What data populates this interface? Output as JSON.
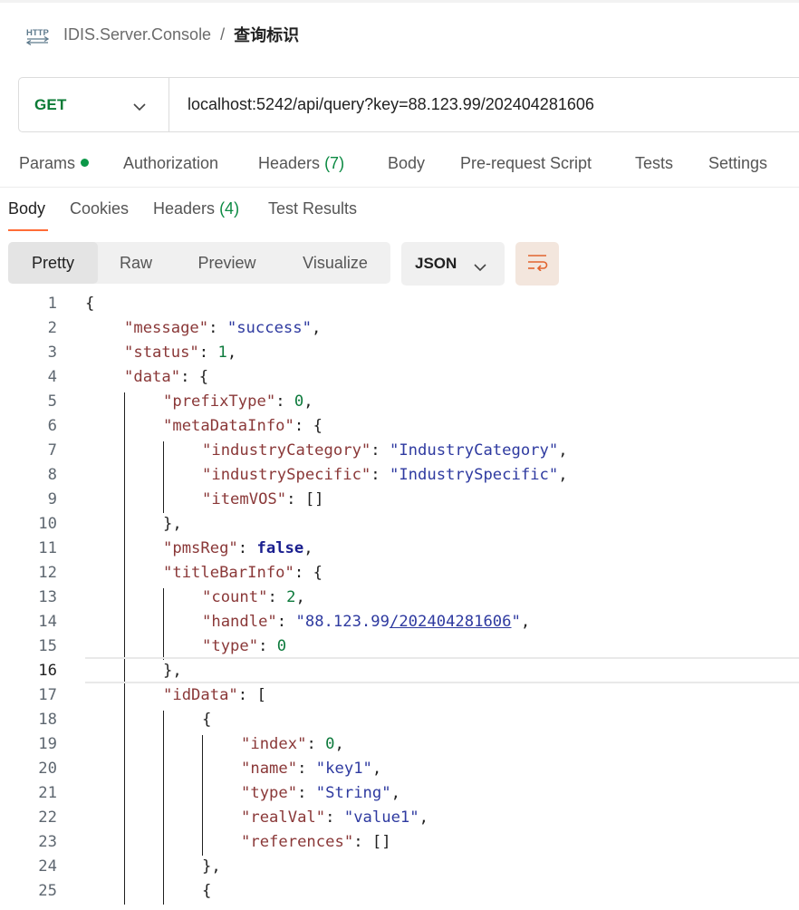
{
  "breadcrumb": {
    "icon": "http-icon",
    "parent": "IDIS.Server.Console",
    "separator": "/",
    "current": "查询标识"
  },
  "request": {
    "method": "GET",
    "url": "localhost:5242/api/query?key=88.123.99/202404281606"
  },
  "request_tabs": [
    {
      "label": "Params",
      "has_dot": true
    },
    {
      "label": "Authorization"
    },
    {
      "label": "Headers",
      "count": "(7)"
    },
    {
      "label": "Body"
    },
    {
      "label": "Pre-request Script"
    },
    {
      "label": "Tests"
    },
    {
      "label": "Settings"
    }
  ],
  "response_tabs": [
    {
      "label": "Body",
      "active": true
    },
    {
      "label": "Cookies"
    },
    {
      "label": "Headers",
      "count": "(4)"
    },
    {
      "label": "Test Results"
    }
  ],
  "view_modes": [
    "Pretty",
    "Raw",
    "Preview",
    "Visualize"
  ],
  "active_view_mode": "Pretty",
  "format": "JSON",
  "colors": {
    "method": "#0b7b36",
    "json_key": "#8a3838",
    "json_string": "#2e3aa0",
    "json_number": "#0d7a3c",
    "accent": "#ff6c37"
  },
  "code": {
    "current_line": 16,
    "lines": [
      {
        "n": "1",
        "tokens": [
          [
            "p",
            "{"
          ]
        ]
      },
      {
        "n": "2",
        "tokens": [
          [
            "k",
            "\"message\""
          ],
          [
            "p",
            ": "
          ],
          [
            "s",
            "\"success\""
          ],
          [
            "p",
            ","
          ]
        ]
      },
      {
        "n": "3",
        "tokens": [
          [
            "k",
            "\"status\""
          ],
          [
            "p",
            ": "
          ],
          [
            "n",
            "1"
          ],
          [
            "p",
            ","
          ]
        ]
      },
      {
        "n": "4",
        "tokens": [
          [
            "k",
            "\"data\""
          ],
          [
            "p",
            ": {"
          ]
        ]
      },
      {
        "n": "5",
        "tokens": [
          [
            "k",
            "\"prefixType\""
          ],
          [
            "p",
            ": "
          ],
          [
            "n",
            "0"
          ],
          [
            "p",
            ","
          ]
        ]
      },
      {
        "n": "6",
        "tokens": [
          [
            "k",
            "\"metaDataInfo\""
          ],
          [
            "p",
            ": {"
          ]
        ]
      },
      {
        "n": "7",
        "tokens": [
          [
            "k",
            "\"industryCategory\""
          ],
          [
            "p",
            ": "
          ],
          [
            "s",
            "\"IndustryCategory\""
          ],
          [
            "p",
            ","
          ]
        ]
      },
      {
        "n": "8",
        "tokens": [
          [
            "k",
            "\"industrySpecific\""
          ],
          [
            "p",
            ": "
          ],
          [
            "s",
            "\"IndustrySpecific\""
          ],
          [
            "p",
            ","
          ]
        ]
      },
      {
        "n": "9",
        "tokens": [
          [
            "k",
            "\"itemVOS\""
          ],
          [
            "p",
            ": []"
          ]
        ]
      },
      {
        "n": "10",
        "tokens": [
          [
            "p",
            "},"
          ]
        ]
      },
      {
        "n": "11",
        "tokens": [
          [
            "k",
            "\"pmsReg\""
          ],
          [
            "p",
            ": "
          ],
          [
            "b",
            "false"
          ],
          [
            "p",
            ","
          ]
        ]
      },
      {
        "n": "12",
        "tokens": [
          [
            "k",
            "\"titleBarInfo\""
          ],
          [
            "p",
            ": {"
          ]
        ]
      },
      {
        "n": "13",
        "tokens": [
          [
            "k",
            "\"count\""
          ],
          [
            "p",
            ": "
          ],
          [
            "n",
            "2"
          ],
          [
            "p",
            ","
          ]
        ]
      },
      {
        "n": "14",
        "tokens": [
          [
            "k",
            "\"handle\""
          ],
          [
            "p",
            ": "
          ],
          [
            "s",
            "\"88.123.99"
          ],
          [
            "su",
            "/202404281606"
          ],
          [
            "s",
            "\""
          ],
          [
            "p",
            ","
          ]
        ]
      },
      {
        "n": "15",
        "tokens": [
          [
            "k",
            "\"type\""
          ],
          [
            "p",
            ": "
          ],
          [
            "n",
            "0"
          ]
        ]
      },
      {
        "n": "16",
        "tokens": [
          [
            "p",
            "},"
          ]
        ]
      },
      {
        "n": "17",
        "tokens": [
          [
            "k",
            "\"idData\""
          ],
          [
            "p",
            ": ["
          ]
        ]
      },
      {
        "n": "18",
        "tokens": [
          [
            "p",
            "{"
          ]
        ]
      },
      {
        "n": "19",
        "tokens": [
          [
            "k",
            "\"index\""
          ],
          [
            "p",
            ": "
          ],
          [
            "n",
            "0"
          ],
          [
            "p",
            ","
          ]
        ]
      },
      {
        "n": "20",
        "tokens": [
          [
            "k",
            "\"name\""
          ],
          [
            "p",
            ": "
          ],
          [
            "s",
            "\"key1\""
          ],
          [
            "p",
            ","
          ]
        ]
      },
      {
        "n": "21",
        "tokens": [
          [
            "k",
            "\"type\""
          ],
          [
            "p",
            ": "
          ],
          [
            "s",
            "\"String\""
          ],
          [
            "p",
            ","
          ]
        ]
      },
      {
        "n": "22",
        "tokens": [
          [
            "k",
            "\"realVal\""
          ],
          [
            "p",
            ": "
          ],
          [
            "s",
            "\"value1\""
          ],
          [
            "p",
            ","
          ]
        ]
      },
      {
        "n": "23",
        "tokens": [
          [
            "k",
            "\"references\""
          ],
          [
            "p",
            ": []"
          ]
        ]
      },
      {
        "n": "24",
        "tokens": [
          [
            "p",
            "},"
          ]
        ]
      },
      {
        "n": "25",
        "tokens": [
          [
            "p",
            "{"
          ]
        ]
      }
    ]
  }
}
